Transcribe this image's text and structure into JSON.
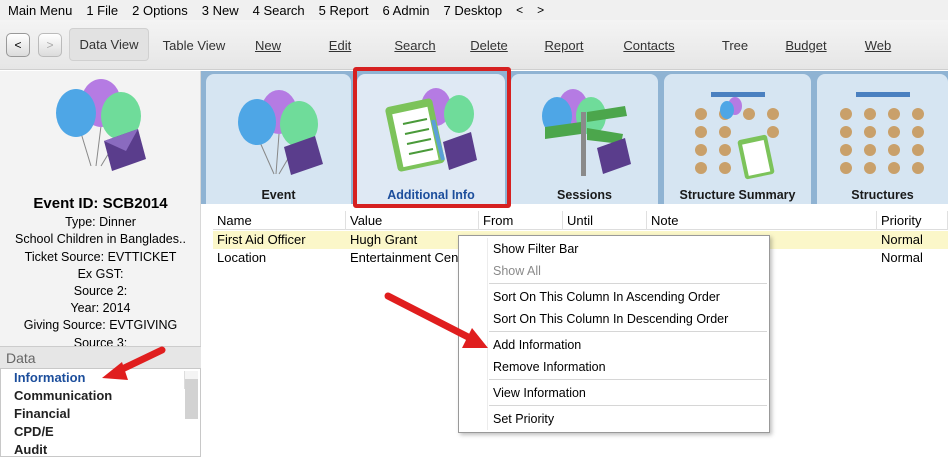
{
  "menubar": {
    "items": [
      "Main Menu",
      "1 File",
      "2 Options",
      "3 New",
      "4 Search",
      "5 Report",
      "6 Admin",
      "7 Desktop"
    ],
    "back_arrow": "<",
    "forward_arrow": ">"
  },
  "toolbar": {
    "back": "<",
    "forward": ">",
    "data_view": "Data View",
    "table_view": "Table View",
    "new": "New",
    "edit": "Edit",
    "search": "Search",
    "delete": "Delete",
    "report": "Report",
    "contacts": "Contacts",
    "tree": "Tree",
    "budget": "Budget",
    "web": "Web"
  },
  "event": {
    "id": "Event ID: SCB2014",
    "type": "Type: Dinner",
    "name": "School Children in Banglades..",
    "ticket_source": "Ticket Source: EVTTICKET",
    "ex_gst": "Ex GST:",
    "source2": "Source 2:",
    "year": "Year: 2014",
    "giving_source": "Giving Source: EVTGIVING",
    "source3_partial": "Source 3:"
  },
  "data_panel": {
    "header": "Data",
    "items": [
      "Information",
      "Communication",
      "Financial",
      "CPD/E",
      "Audit"
    ]
  },
  "tiles": [
    {
      "label": "Event"
    },
    {
      "label": "Additional Info"
    },
    {
      "label": "Sessions"
    },
    {
      "label": "Structure Summary"
    },
    {
      "label": "Structures"
    }
  ],
  "grid": {
    "columns": [
      "Name",
      "Value",
      "From",
      "Until",
      "Note",
      "Priority"
    ],
    "rows": [
      {
        "name": "First Aid Officer",
        "value": "Hugh Grant",
        "priority": "Normal"
      },
      {
        "name": "Location",
        "value": "Entertainment Cen",
        "priority": "Normal"
      }
    ]
  },
  "context_menu": {
    "show_filter_bar": "Show Filter Bar",
    "show_all": "Show All",
    "sort_asc": "Sort On This Column In Ascending Order",
    "sort_desc": "Sort On This Column In Descending Order",
    "add_info": "Add Information",
    "remove_info": "Remove Information",
    "view_info": "View Information",
    "set_priority": "Set Priority"
  },
  "colors": {
    "highlight": "#d62020",
    "selected_text": "#1c4e9c",
    "row_highlight": "#fbf7c9",
    "tile_bg": "#d6e5f2",
    "panel_bg": "#8fb3d3"
  }
}
